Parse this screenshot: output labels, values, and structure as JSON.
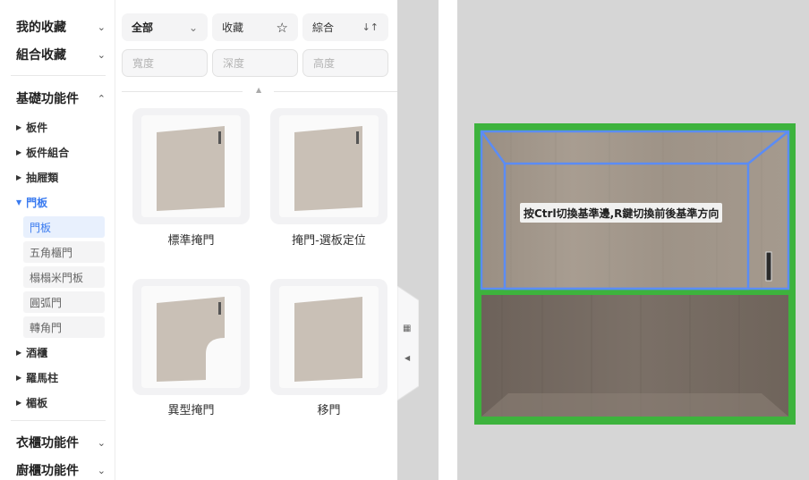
{
  "sidebar": {
    "favorites": {
      "label": "我的收藏",
      "chevron": "chevron-down-icon"
    },
    "combo_favorites": {
      "label": "組合收藏",
      "chevron": "chevron-down-icon"
    },
    "basic": {
      "label": "基礎功能件",
      "chevron": "chevron-up-icon"
    },
    "tree": [
      {
        "label": "板件",
        "expanded": false
      },
      {
        "label": "板件組合",
        "expanded": false
      },
      {
        "label": "抽屜類",
        "expanded": false
      },
      {
        "label": "門板",
        "expanded": true
      }
    ],
    "door_children": [
      "門板",
      "五角櫃門",
      "榻榻米門板",
      "圓弧門",
      "轉角門"
    ],
    "tree_after": [
      {
        "label": "酒櫃"
      },
      {
        "label": "羅馬柱"
      },
      {
        "label": "楣板"
      }
    ],
    "wardrobe": {
      "label": "衣櫃功能件",
      "chevron": "chevron-down-icon"
    },
    "kitchen": {
      "label": "廚櫃功能件",
      "chevron": "chevron-down-icon"
    }
  },
  "filters": {
    "category": {
      "label": "全部",
      "icon": "chevron-down-icon"
    },
    "favorite": {
      "label": "收藏",
      "icon": "star-icon"
    },
    "sort": {
      "label": "綜合",
      "icon": "sort-icon"
    },
    "width_placeholder": "寬度",
    "depth_placeholder": "深度",
    "height_placeholder": "高度"
  },
  "products": [
    {
      "name": "標準掩門"
    },
    {
      "name": "掩門-選板定位"
    },
    {
      "name": "異型掩門"
    },
    {
      "name": "移門"
    }
  ],
  "viewport": {
    "hint": "按Ctrl切換基準邊,R鍵切換前後基準方向"
  },
  "colors": {
    "accent": "#3a7bf0",
    "frame_green": "#3db33d",
    "outline_blue": "#5b8cf5",
    "door_panel": "#c9c0b6"
  }
}
